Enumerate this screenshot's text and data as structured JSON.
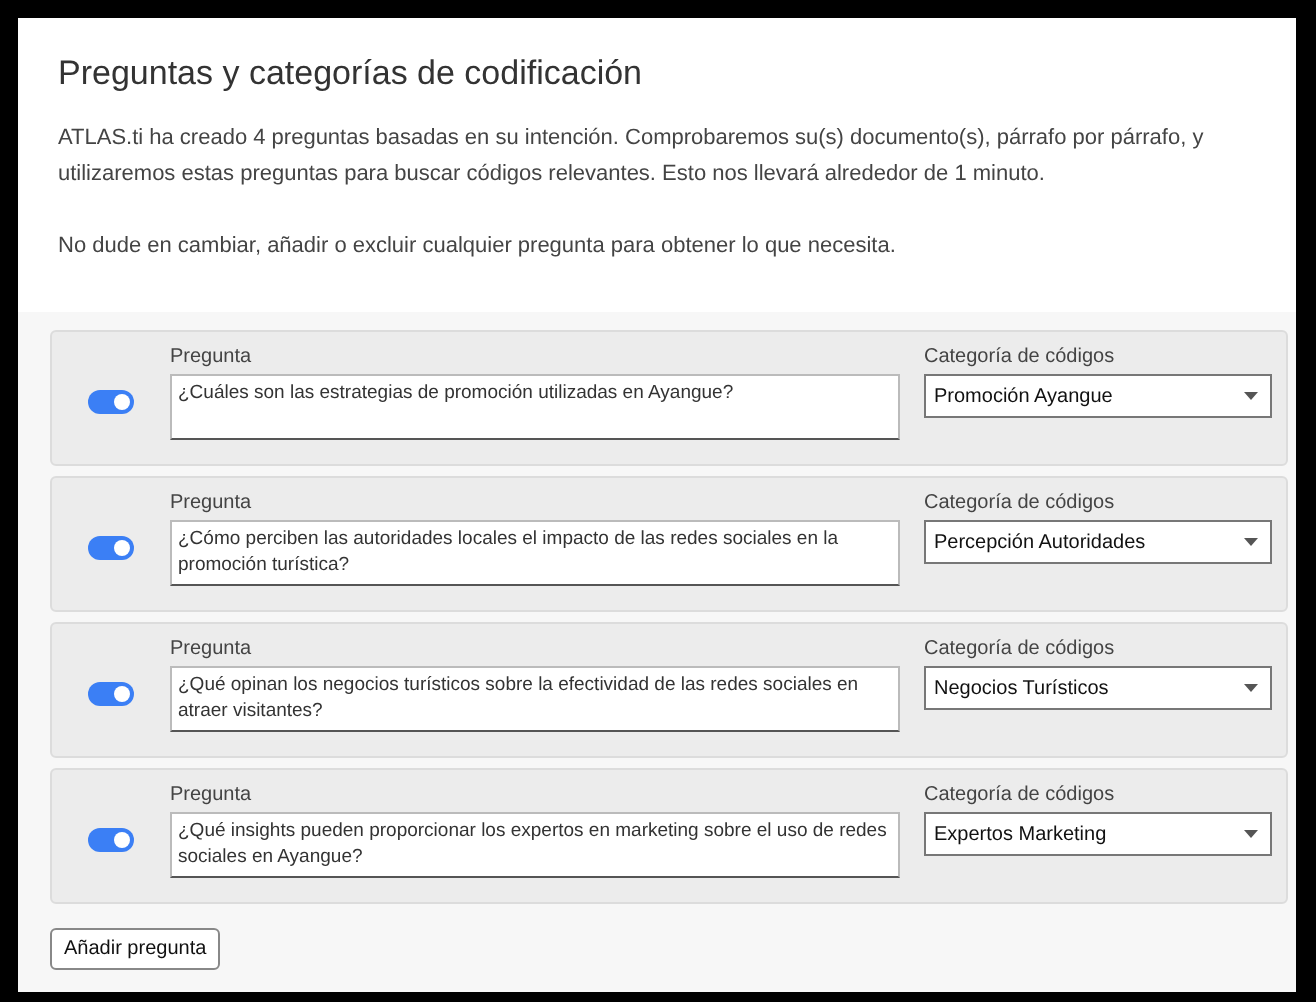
{
  "title": "Preguntas y categorías de codificación",
  "intro": [
    "ATLAS.ti ha creado 4 preguntas basadas en su intención. Comprobaremos su(s) documento(s), párrafo por párrafo, y utilizaremos estas preguntas para buscar códigos relevantes. Esto nos llevará alrededor de 1 minuto.",
    "No dude en cambiar, añadir o excluir cualquier pregunta para obtener lo que necesita."
  ],
  "questions": [
    {
      "on": true,
      "question_label": "Pregunta",
      "question": "¿Cuáles son las estrategias de promoción utilizadas en Ayangue?",
      "category_label": "Categoría de códigos",
      "category": "Promoción Ayangue"
    },
    {
      "on": true,
      "question_label": "Pregunta",
      "question": "¿Cómo perciben las autoridades locales el impacto de las redes sociales en la promoción turística?",
      "category_label": "Categoría de códigos",
      "category": "Percepción Autoridades"
    },
    {
      "on": true,
      "question_label": "Pregunta",
      "question": "¿Qué opinan los negocios turísticos sobre la efectividad de las redes sociales en atraer visitantes?",
      "category_label": "Categoría de códigos",
      "category": "Negocios Turísticos"
    },
    {
      "on": true,
      "question_label": "Pregunta",
      "question": "¿Qué insights pueden proporcionar los expertos en marketing sobre el uso de redes sociales en Ayangue?",
      "category_label": "Categoría de códigos",
      "category": "Expertos Marketing"
    }
  ],
  "add_button": "Añadir pregunta"
}
